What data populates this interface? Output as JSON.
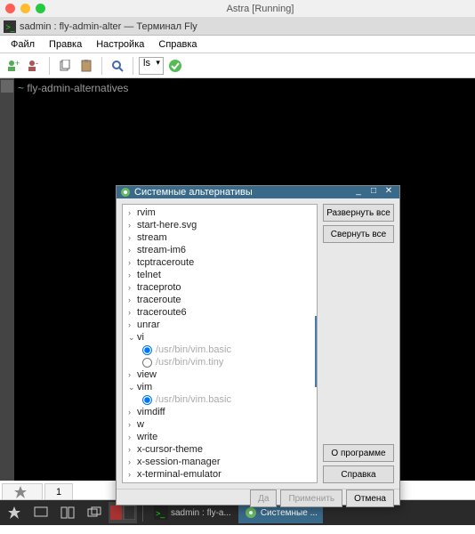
{
  "mac": {
    "title": "Astra [Running]",
    "colors": {
      "red": "#ff5f56",
      "yellow": "#ffbd2e",
      "green": "#27c93f"
    }
  },
  "inner_window": {
    "title": "sadmin : fly-admin-alter — Терминал Fly"
  },
  "menubar": {
    "file": "Файл",
    "edit": "Правка",
    "settings": "Настройка",
    "help": "Справка"
  },
  "toolbar": {
    "combo_value": "ls"
  },
  "terminal": {
    "prompt_prefix": "~",
    "command": "fly-admin-alternatives"
  },
  "dialog": {
    "title": "Системные альтернативы",
    "buttons": {
      "expand_all": "Развернуть все",
      "collapse_all": "Свернуть все",
      "about": "О программе",
      "help": "Справка",
      "yes": "Да",
      "apply": "Применить",
      "cancel": "Отмена"
    },
    "tree": [
      {
        "label": "rvim",
        "expanded": false
      },
      {
        "label": "start-here.svg",
        "expanded": false
      },
      {
        "label": "stream",
        "expanded": false
      },
      {
        "label": "stream-im6",
        "expanded": false
      },
      {
        "label": "tcptraceroute",
        "expanded": false
      },
      {
        "label": "telnet",
        "expanded": false
      },
      {
        "label": "traceproto",
        "expanded": false
      },
      {
        "label": "traceroute",
        "expanded": false
      },
      {
        "label": "traceroute6",
        "expanded": false
      },
      {
        "label": "unrar",
        "expanded": false
      },
      {
        "label": "vi",
        "expanded": true,
        "children": [
          {
            "label": "/usr/bin/vim.basic",
            "selected": true
          },
          {
            "label": "/usr/bin/vim.tiny",
            "selected": false
          }
        ]
      },
      {
        "label": "view",
        "expanded": false
      },
      {
        "label": "vim",
        "expanded": true,
        "children": [
          {
            "label": "/usr/bin/vim.basic",
            "selected": true
          }
        ]
      },
      {
        "label": "vimdiff",
        "expanded": false
      },
      {
        "label": "w",
        "expanded": false
      },
      {
        "label": "write",
        "expanded": false
      },
      {
        "label": "x-cursor-theme",
        "expanded": false
      },
      {
        "label": "x-session-manager",
        "expanded": false
      },
      {
        "label": "x-terminal-emulator",
        "expanded": false
      }
    ]
  },
  "tabs": {
    "tab1": "1"
  },
  "taskbar": {
    "item1": "sadmin : fly-a...",
    "item2": "Системные ..."
  }
}
